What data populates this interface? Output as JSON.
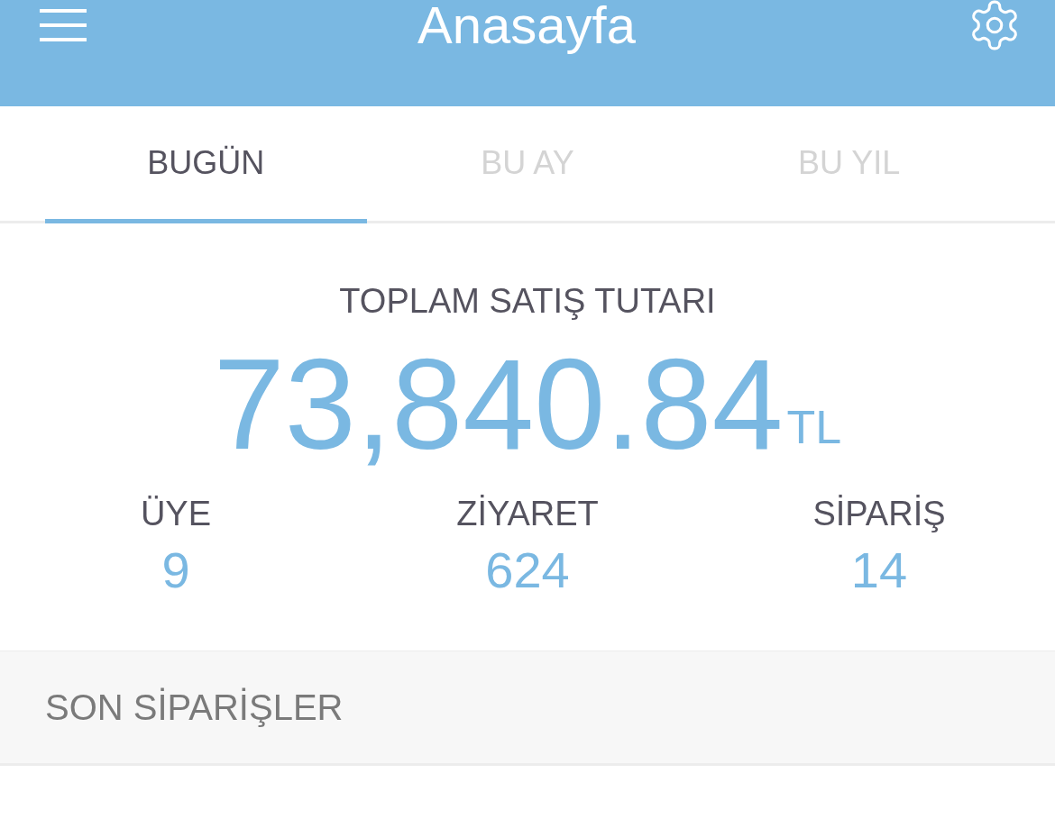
{
  "header": {
    "title": "Anasayfa"
  },
  "tabs": [
    {
      "label": "BUGÜN",
      "selected": true
    },
    {
      "label": "BU AY",
      "selected": false
    },
    {
      "label": "BU YIL",
      "selected": false
    }
  ],
  "summary": {
    "label": "TOPLAM SATIŞ TUTARI",
    "amount": "73,840.84",
    "currency": "TL"
  },
  "stats": [
    {
      "label": "ÜYE",
      "value": "9"
    },
    {
      "label": "ZİYARET",
      "value": "624"
    },
    {
      "label": "SİPARİŞ",
      "value": "14"
    }
  ],
  "section": {
    "title": "SON SİPARİŞLER"
  }
}
